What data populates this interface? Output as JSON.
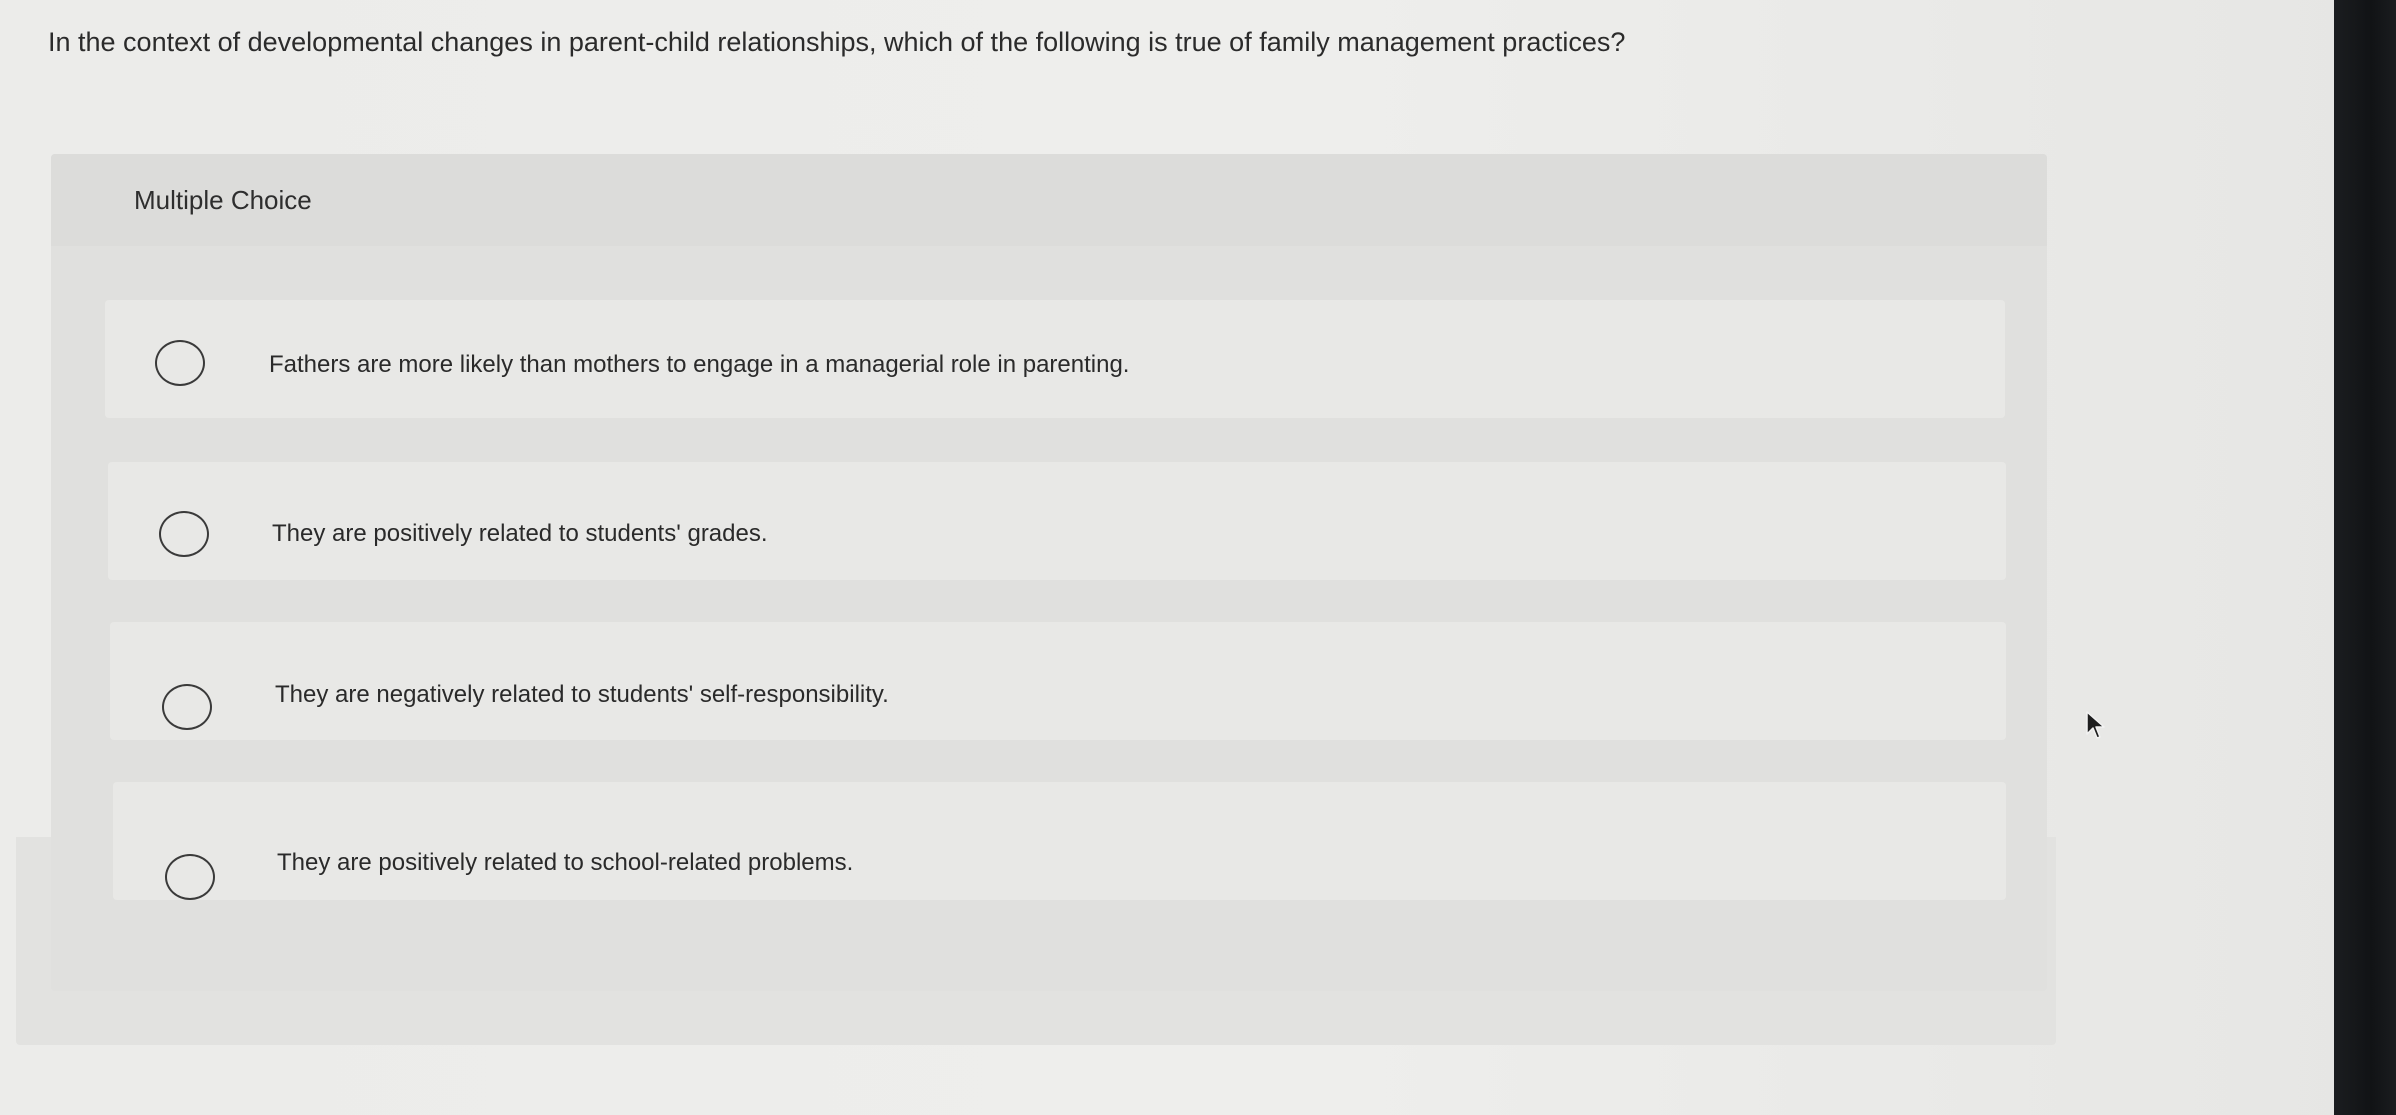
{
  "question": {
    "text": "In the context of developmental changes in parent-child relationships, which of the following is true of family management practices?"
  },
  "panel": {
    "title": "Multiple Choice"
  },
  "options": [
    {
      "label": "Fathers are more likely than mothers to engage in a managerial role in parenting.",
      "selected": false
    },
    {
      "label": "They are positively related to students' grades.",
      "selected": false
    },
    {
      "label": "They are negatively related to students' self-responsibility.",
      "selected": false
    },
    {
      "label": "They are positively related to school-related problems.",
      "selected": false
    }
  ],
  "colors": {
    "background": "#ececea",
    "panel": "#e0e0de",
    "option": "#e8e8e6",
    "text": "#2b2b2b",
    "bezel": "#111315"
  },
  "icons": {
    "cursor": "mouse-pointer-icon",
    "radio": "radio-circle-icon"
  }
}
